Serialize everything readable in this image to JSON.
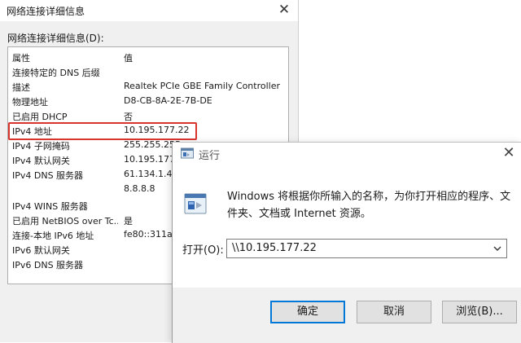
{
  "network_window": {
    "title": "网络连接详细信息",
    "list_label": "网络连接详细信息(D):",
    "columns": [
      "属性",
      "值"
    ],
    "rows": [
      {
        "prop": "连接特定的 DNS 后缀",
        "value": ""
      },
      {
        "prop": "描述",
        "value": "Realtek PCIe GBE Family Controller"
      },
      {
        "prop": "物理地址",
        "value": "D8-CB-8A-2E-7B-DE"
      },
      {
        "prop": "已启用 DHCP",
        "value": "否"
      },
      {
        "prop": "IPv4 地址",
        "value": "10.195.177.22"
      },
      {
        "prop": "IPv4 子网掩码",
        "value": "255.255.255"
      },
      {
        "prop": "IPv4 默认网关",
        "value": "10.195.177."
      },
      {
        "prop": "IPv4 DNS 服务器",
        "value": "61.134.1.4"
      },
      {
        "prop": "",
        "value": "8.8.8.8"
      },
      {
        "prop": "IPv4 WINS 服务器",
        "value": ""
      },
      {
        "prop": "已启用 NetBIOS over Tc...",
        "value": "是"
      },
      {
        "prop": "连接-本地 IPv6 地址",
        "value": "fe80::311a:a"
      },
      {
        "prop": "IPv6 默认网关",
        "value": ""
      },
      {
        "prop": "IPv6 DNS 服务器",
        "value": ""
      }
    ],
    "highlight_color": "#d9352f"
  },
  "run_dialog": {
    "title": "运行",
    "description": "Windows 将根据你所输入的名称，为你打开相应的程序、文件夹、文档或 Internet 资源。",
    "open_label": "打开(O):",
    "open_value": "\\\\10.195.177.22",
    "buttons": {
      "ok": "确定",
      "cancel": "取消",
      "browse": "浏览(B)..."
    },
    "accent": "#0078d7"
  }
}
